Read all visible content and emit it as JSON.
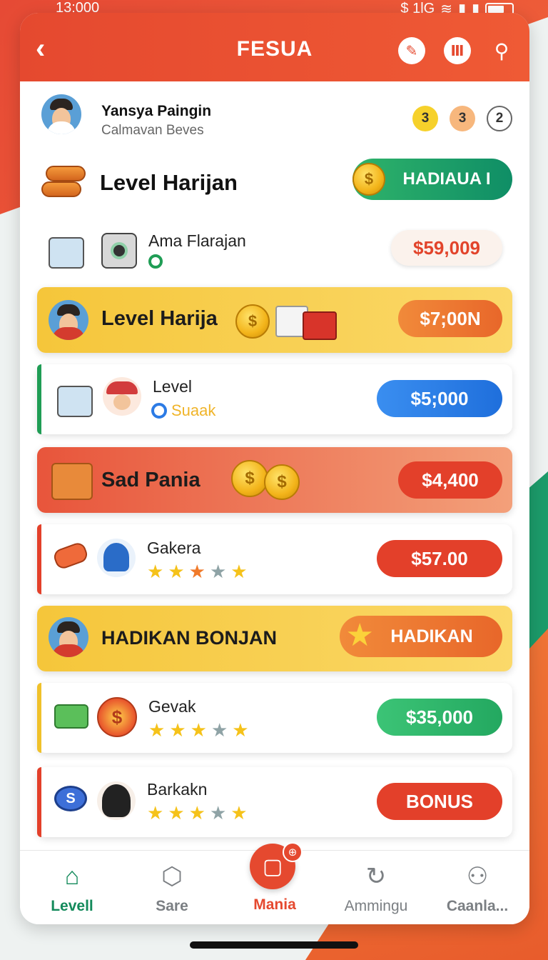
{
  "status_bar": {
    "time": "13:000",
    "network": "$ 1lG"
  },
  "header": {
    "title": "FESUA",
    "back_label": "‹"
  },
  "profile": {
    "name": "Yansya Paingin",
    "subtitle": "Calmavan Beves",
    "badges": [
      "3",
      "3",
      "2"
    ]
  },
  "level": {
    "title": "Level Harijan",
    "button_label": "HADIAUA I"
  },
  "items": [
    {
      "name": "Ama Flarajan",
      "price": "$59,009"
    },
    {
      "banner": "Level Harija",
      "price": "$7;00N"
    },
    {
      "name": "Level",
      "sub": "Suaak",
      "price": "$5;000"
    },
    {
      "banner": "Sad Pania",
      "price": "$4,400"
    },
    {
      "name": "Gakera",
      "price": "$57.00",
      "rating": "3.5"
    },
    {
      "banner": "HADIKAN BONJAN",
      "button": "HADIKAN"
    },
    {
      "name": "Gevak",
      "price": "$35,000",
      "rating": "3.5"
    },
    {
      "name": "Barkakn",
      "price": "BONUS",
      "rating": "3.5"
    }
  ],
  "nav": [
    {
      "label": "Levell",
      "icon": "home-icon",
      "active": true
    },
    {
      "label": "Sare",
      "icon": "hexagon-icon"
    },
    {
      "label": "Mania",
      "icon": "center-square-icon"
    },
    {
      "label": "Ammingu",
      "icon": "refresh-icon"
    },
    {
      "label": "Caanla...",
      "icon": "user-icon"
    }
  ],
  "colors": {
    "primary_red": "#e5492f",
    "green": "#138a5b",
    "blue": "#2c7be5",
    "gold": "#f5c21a"
  }
}
